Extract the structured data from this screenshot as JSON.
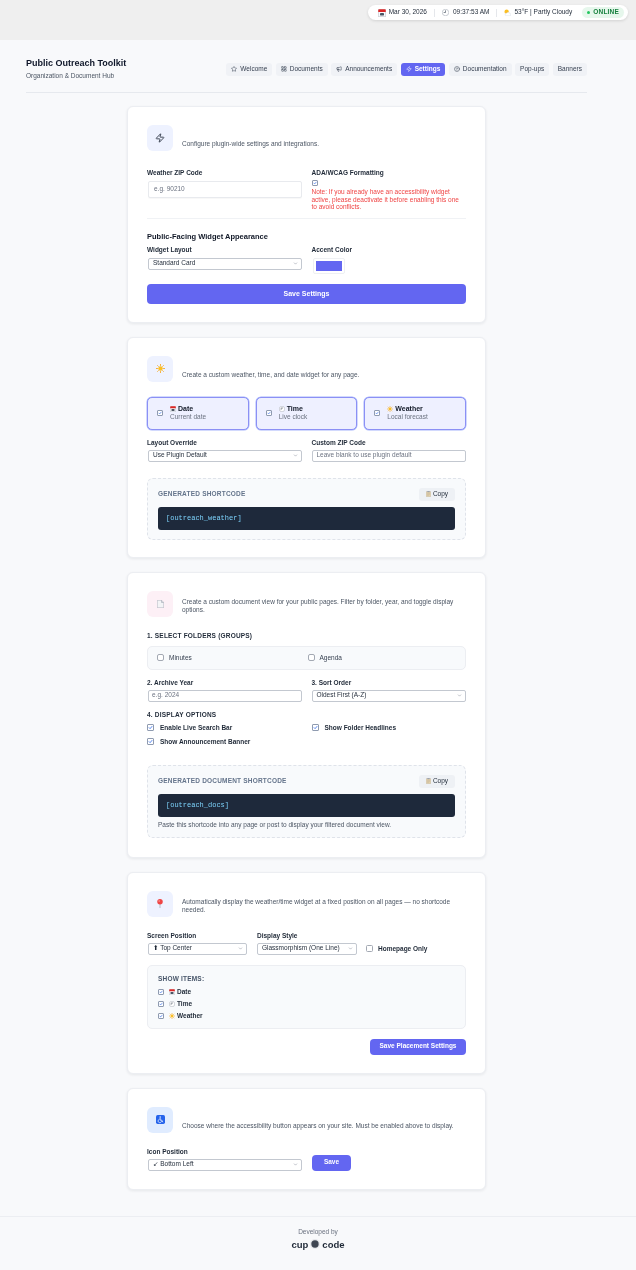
{
  "status_bar": {
    "date": "Mar 30, 2026",
    "time": "09:37:53 AM",
    "weather": "53°F | Partly Cloudy",
    "status": "ONLINE"
  },
  "header": {
    "title": "Public Outreach Toolkit",
    "subtitle": "Organization & Document Hub"
  },
  "tabs": [
    {
      "label": "Welcome",
      "selected": false
    },
    {
      "label": "Documents",
      "selected": false
    },
    {
      "label": "Announcements",
      "selected": false
    },
    {
      "label": "Settings",
      "selected": true
    },
    {
      "label": "Documentation",
      "selected": false
    },
    {
      "label": "Pop-ups",
      "selected": false
    },
    {
      "label": "Banners",
      "selected": false
    }
  ],
  "global_settings": {
    "description": "Configure plugin-wide settings and integrations.",
    "zip_field": {
      "label": "Weather ZIP Code",
      "placeholder": "e.g. 90210"
    },
    "ada": {
      "label": "ADA/WCAG Formatting",
      "checked": true,
      "note": "Note: If you already have an accessibility widget active, please deactivate it before enabling this one to avoid conflicts."
    },
    "appearance_heading": "Public-Facing Widget Appearance",
    "layout_select": {
      "label": "Widget Layout",
      "value": "Standard Card"
    },
    "accent_color": {
      "label": "Accent Color",
      "color": "#6366f1"
    },
    "save_button": "Save Settings"
  },
  "weather_widget": {
    "description": "Create a custom weather, time, and date widget for any page.",
    "options": [
      {
        "title": "Date",
        "subtitle": "Current date",
        "checked": true
      },
      {
        "title": "Time",
        "subtitle": "Live clock",
        "checked": true
      },
      {
        "title": "Weather",
        "subtitle": "Local forecast",
        "checked": true
      }
    ],
    "layout_select": {
      "label": "Layout Override",
      "value": "Use Plugin Default"
    },
    "zip_field": {
      "label": "Custom ZIP Code",
      "placeholder": "Leave blank to use plugin default"
    },
    "shortcode": {
      "heading": "GENERATED SHORTCODE",
      "copy": "Copy",
      "code": "[outreach_weather]"
    }
  },
  "document_view": {
    "description": "Create a custom document view for your public pages. Filter by folder, year, and toggle display options.",
    "folders_heading": "1. SELECT FOLDERS (GROUPS)",
    "folders": [
      {
        "label": "Minutes",
        "checked": false
      },
      {
        "label": "Agenda",
        "checked": false
      }
    ],
    "year_field": {
      "label": "2. Archive Year",
      "placeholder": "e.g. 2024"
    },
    "sort_select": {
      "label": "3. Sort Order",
      "value": "Oldest First (A-Z)"
    },
    "display_heading": "4. DISPLAY OPTIONS",
    "display_options": [
      {
        "label": "Enable Live Search Bar",
        "checked": true
      },
      {
        "label": "Show Folder Headlines",
        "checked": true
      },
      {
        "label": "Show Announcement Banner",
        "checked": true
      }
    ],
    "shortcode": {
      "heading": "GENERATED DOCUMENT SHORTCODE",
      "copy": "Copy",
      "code": "[outreach_docs]",
      "note": "Paste this shortcode into any page or post to display your filtered document view."
    }
  },
  "auto_placement": {
    "description": "Automatically display the weather/time widget at a fixed position on all pages — no shortcode needed.",
    "position_select": {
      "label": "Screen Position",
      "value": "⬆ Top Center"
    },
    "style_select": {
      "label": "Display Style",
      "value": "Glassmorphism (One Line)"
    },
    "homepage_only": {
      "label": "Homepage Only",
      "checked": false
    },
    "items_heading": "SHOW ITEMS:",
    "items": [
      {
        "label": "Date",
        "checked": true
      },
      {
        "label": "Time",
        "checked": true
      },
      {
        "label": "Weather",
        "checked": true
      }
    ],
    "save_button": "Save Placement Settings"
  },
  "accessibility_button": {
    "description": "Choose where the accessibility button appears on your site. Must be enabled above to display.",
    "position_select": {
      "label": "Icon Position",
      "value": "↙ Bottom Left"
    },
    "save_button": "Save"
  },
  "footer": {
    "credit": "Developed by",
    "logo_left": "cup",
    "logo_right": "code"
  }
}
